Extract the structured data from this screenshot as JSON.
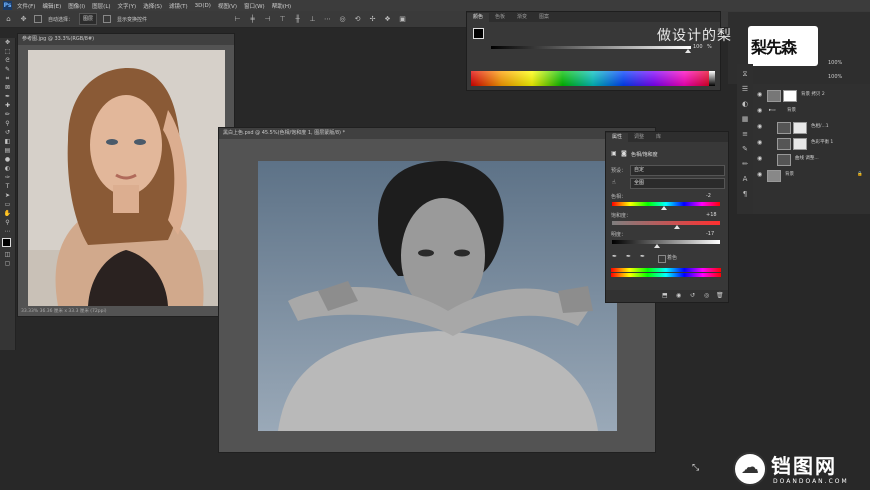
{
  "app": {
    "logo": "Ps"
  },
  "menu": [
    "文件(F)",
    "编辑(E)",
    "图像(I)",
    "图层(L)",
    "文字(Y)",
    "选择(S)",
    "滤镜(T)",
    "3D(D)",
    "视图(V)",
    "窗口(W)",
    "帮助(H)"
  ],
  "options": {
    "home_icon": "home-icon",
    "move_icon": "move-icon",
    "auto_select_label": "自动选择：",
    "auto_select_value": "图层",
    "show_transform_label": "显示变换控件"
  },
  "doc1": {
    "title": "参考图.jpg @ 33.3%(RGB/8#)",
    "status": "33.33%  36.36 厘米 x 33.3 厘米 (72ppi)"
  },
  "doc2": {
    "title": "黑白上色.psd @ 45.5%(色相/饱和度 1, 图层蒙版/8) *"
  },
  "color_panel": {
    "tabs": [
      "颜色",
      "色板",
      "渐变",
      "图案"
    ],
    "value": "100",
    "unit": "%"
  },
  "properties": {
    "tabs": [
      "属性",
      "调整",
      "库"
    ],
    "header": "色相/饱和度",
    "preset_label": "预设：",
    "preset_value": "自定",
    "channel_value": "全图",
    "hue_label": "色相：",
    "hue_value": "-2",
    "saturation_label": "饱和度：",
    "saturation_value": "+18",
    "lightness_label": "明度：",
    "lightness_value": "-17",
    "colorize_label": "着色",
    "hue_pos": 0.48,
    "saturation_pos": 0.6,
    "lightness_pos": 0.42
  },
  "right_top": {
    "overlay_text": "做设计的梨",
    "logo_text": "梨先森",
    "opacity_value": "100%",
    "fill_value": "100%"
  },
  "layers": [
    {
      "name": "背景 拷贝 2",
      "type": "layer"
    },
    {
      "name": "背景",
      "type": "group"
    },
    {
      "name": "色相/...1",
      "type": "adjustment"
    },
    {
      "name": "色彩平衡 1",
      "type": "adjustment"
    },
    {
      "name": "曲线 调整...",
      "type": "adjustment"
    },
    {
      "name": "背景",
      "type": "layer"
    }
  ],
  "watermark": {
    "cn": "铛图网",
    "en": "DOANDOAN.COM"
  }
}
